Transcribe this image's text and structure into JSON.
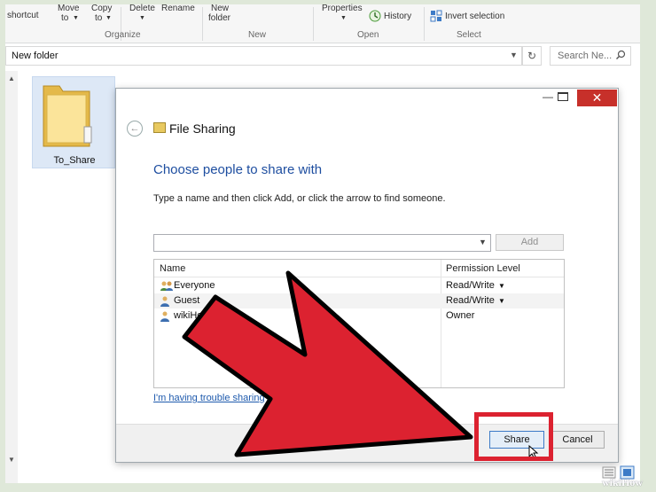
{
  "ribbon": {
    "shortcut_label": "shortcut",
    "move_to_label": "Move",
    "move_to_sub": "to",
    "copy_to_label": "Copy",
    "copy_to_sub": "to",
    "delete_label": "Delete",
    "rename_label": "Rename",
    "new_folder_label": "New",
    "new_folder_sub": "folder",
    "properties_label": "Properties",
    "history_label": "History",
    "invert_selection_label": "Invert selection",
    "groups": {
      "organize": "Organize",
      "new": "New",
      "open": "Open",
      "select": "Select"
    }
  },
  "address_bar": {
    "path": "New folder"
  },
  "search": {
    "placeholder": "Search Ne..."
  },
  "folder": {
    "name": "To_Share"
  },
  "dialog": {
    "title": "File Sharing",
    "heading": "Choose people to share with",
    "instruction": "Type a name and then click Add, or click the arrow to find someone.",
    "name_input_value": "",
    "add_label": "Add",
    "columns": {
      "name": "Name",
      "permission": "Permission Level"
    },
    "entries": [
      {
        "name": "Everyone",
        "permission": "Read/Write",
        "has_dropdown": true,
        "icon": "group-user-icon"
      },
      {
        "name": "Guest",
        "permission": "Read/Write",
        "has_dropdown": true,
        "icon": "user-icon"
      },
      {
        "name": "wikiHow",
        "permission": "Owner",
        "has_dropdown": false,
        "icon": "user-icon"
      }
    ],
    "trouble_link": "I'm having trouble sharing",
    "share_label": "Share",
    "cancel_label": "Cancel"
  },
  "watermark": "wikiHow",
  "colors": {
    "accent_blue": "#1e4ea0",
    "close_red": "#c7302a",
    "annotation_red": "#dc2230"
  }
}
